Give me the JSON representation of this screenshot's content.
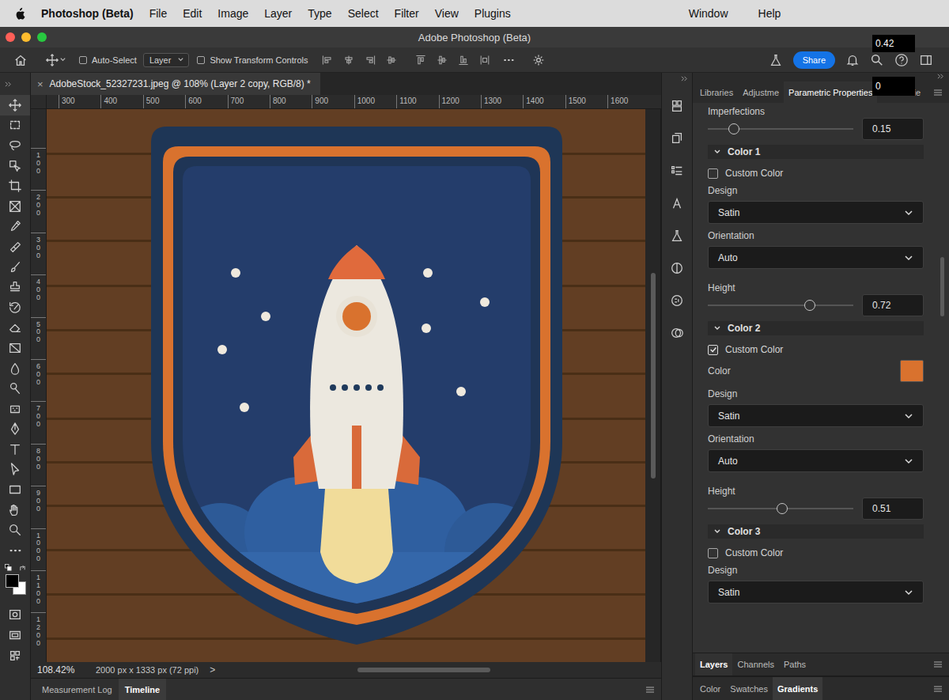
{
  "menu_bar": {
    "app": "Photoshop (Beta)",
    "items": [
      "File",
      "Edit",
      "Image",
      "Layer",
      "Type",
      "Select",
      "Filter",
      "View",
      "Plugins"
    ],
    "right_items": [
      "Window",
      "Help"
    ]
  },
  "window": {
    "title": "Adobe Photoshop (Beta)"
  },
  "overlays": [
    {
      "text": "0.42"
    },
    {
      "text": "0"
    }
  ],
  "options_bar": {
    "auto_select": {
      "label": "Auto-Select",
      "checked": false
    },
    "target": "Layer",
    "show_transform": {
      "label": "Show Transform Controls",
      "checked": false
    },
    "share": "Share"
  },
  "document_tab": {
    "title": "AdobeStock_52327231.jpeg @ 108% (Layer 2 copy, RGB/8) *",
    "close": "×"
  },
  "rulers": {
    "horizontal": [
      "300",
      "400",
      "500",
      "600",
      "700",
      "800",
      "900",
      "1000",
      "1100",
      "1200",
      "1300",
      "1400",
      "1500",
      "1600"
    ],
    "vertical": [
      "100",
      "200",
      "300",
      "400",
      "500",
      "600",
      "700",
      "800",
      "900",
      "1000",
      "1100",
      "1200"
    ]
  },
  "status_bar": {
    "zoom": "108.42%",
    "size": "2000 px x 1333 px (72 ppi)",
    "arrow": ">"
  },
  "bottom_tabs": [
    {
      "label": "Measurement Log",
      "selected": false
    },
    {
      "label": "Timeline",
      "selected": true
    }
  ],
  "panel": {
    "tabs": [
      {
        "label": "Libraries",
        "selected": false
      },
      {
        "label": "Adjustme",
        "selected": false
      },
      {
        "label": "Parametric Properties",
        "selected": true
      },
      {
        "label": "ie",
        "selected": false
      }
    ],
    "rows": [
      {
        "kind": "slider",
        "label": "Imperfections",
        "level": 0.18,
        "value": "0.15"
      },
      {
        "kind": "section",
        "label": "Color 1",
        "expanded": true
      },
      {
        "kind": "checkbox",
        "label": "Custom Color",
        "checked": false
      },
      {
        "kind": "dropdown",
        "label": "Design",
        "value": "Satin"
      },
      {
        "kind": "dropdown",
        "label": "Orientation",
        "value": "Auto"
      },
      {
        "kind": "slider",
        "label": "Height",
        "level": 0.7,
        "value": "0.72"
      },
      {
        "kind": "section",
        "label": "Color 2",
        "expanded": true
      },
      {
        "kind": "checkbox",
        "label": "Custom Color",
        "checked": true
      },
      {
        "kind": "color",
        "label": "Color",
        "color": "#d9722e"
      },
      {
        "kind": "dropdown",
        "label": "Design",
        "value": "Satin"
      },
      {
        "kind": "dropdown",
        "label": "Orientation",
        "value": "Auto"
      },
      {
        "kind": "slider",
        "label": "Height",
        "level": 0.51,
        "value": "0.51"
      },
      {
        "kind": "section",
        "label": "Color 3",
        "expanded": true
      },
      {
        "kind": "checkbox",
        "label": "Custom Color",
        "checked": false
      },
      {
        "kind": "dropdown",
        "label": "Design",
        "value": "Satin"
      }
    ]
  },
  "layers_tabs": [
    {
      "label": "Layers",
      "selected": true
    },
    {
      "label": "Channels",
      "selected": false
    },
    {
      "label": "Paths",
      "selected": false
    }
  ],
  "color_tabs": [
    {
      "label": "Color",
      "selected": false
    },
    {
      "label": "Swatches",
      "selected": false
    },
    {
      "label": "Gradients",
      "selected": true
    }
  ]
}
